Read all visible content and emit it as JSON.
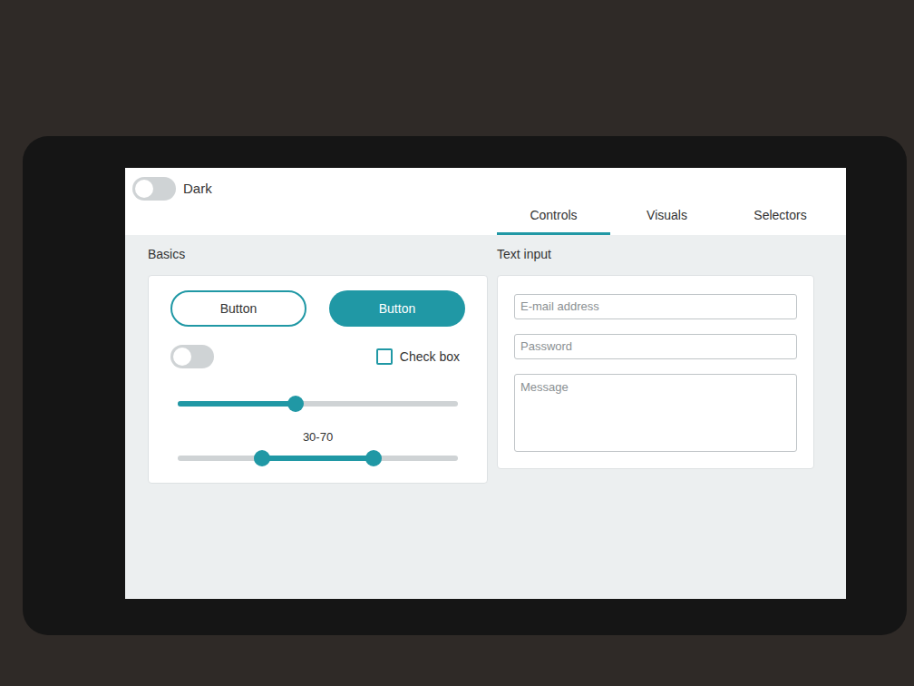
{
  "theme_switch": {
    "label": "Dark",
    "on": false
  },
  "tabs": [
    {
      "label": "Controls",
      "selected": true
    },
    {
      "label": "Visuals",
      "selected": false
    },
    {
      "label": "Selectors",
      "selected": false
    }
  ],
  "basics": {
    "title": "Basics",
    "buttons": [
      {
        "label": "Button",
        "kind": "outline"
      },
      {
        "label": "Button",
        "kind": "filled"
      }
    ],
    "switch": {
      "on": false
    },
    "checkbox": {
      "label": "Check box",
      "checked": false
    },
    "slider": {
      "level": 0.42
    },
    "range": {
      "reading": "30-70",
      "low": 0.3,
      "high": 0.7
    }
  },
  "text_input": {
    "title": "Text input",
    "fields": [
      {
        "placeholder": "E-mail address",
        "kind": "line"
      },
      {
        "placeholder": "Password",
        "kind": "line"
      },
      {
        "placeholder": "Message",
        "kind": "area"
      }
    ]
  }
}
